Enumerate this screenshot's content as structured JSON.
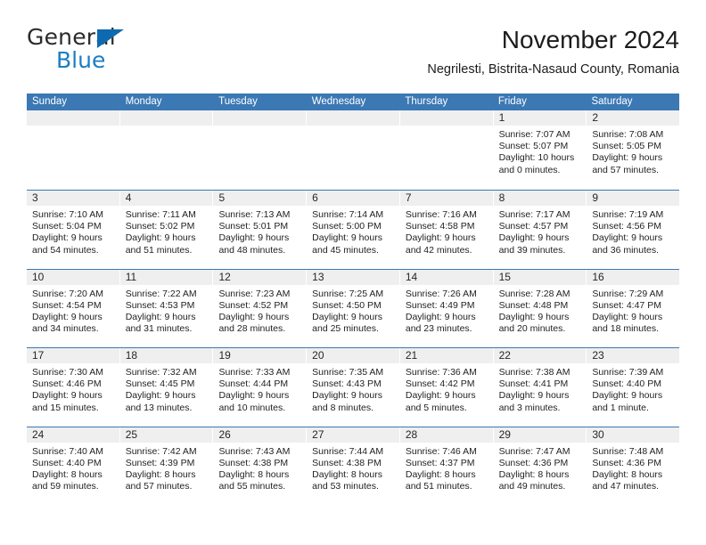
{
  "brand": {
    "name_top": "General",
    "name_bottom": "Blue",
    "triangle_color": "#0e6ab0",
    "blue_text_color": "#1b7ec4"
  },
  "header": {
    "title": "November 2024",
    "subtitle": "Negrilesti, Bistrita-Nasaud County, Romania"
  },
  "theme": {
    "header_blue": "#3b78b4",
    "daynum_band": "#efefef",
    "row_rule": "#3b78b4"
  },
  "weekdays": [
    "Sunday",
    "Monday",
    "Tuesday",
    "Wednesday",
    "Thursday",
    "Friday",
    "Saturday"
  ],
  "weeks": [
    [
      {
        "day": "",
        "lines": []
      },
      {
        "day": "",
        "lines": []
      },
      {
        "day": "",
        "lines": []
      },
      {
        "day": "",
        "lines": []
      },
      {
        "day": "",
        "lines": []
      },
      {
        "day": "1",
        "lines": [
          "Sunrise: 7:07 AM",
          "Sunset: 5:07 PM",
          "Daylight: 10 hours",
          "and 0 minutes."
        ]
      },
      {
        "day": "2",
        "lines": [
          "Sunrise: 7:08 AM",
          "Sunset: 5:05 PM",
          "Daylight: 9 hours",
          "and 57 minutes."
        ]
      }
    ],
    [
      {
        "day": "3",
        "lines": [
          "Sunrise: 7:10 AM",
          "Sunset: 5:04 PM",
          "Daylight: 9 hours",
          "and 54 minutes."
        ]
      },
      {
        "day": "4",
        "lines": [
          "Sunrise: 7:11 AM",
          "Sunset: 5:02 PM",
          "Daylight: 9 hours",
          "and 51 minutes."
        ]
      },
      {
        "day": "5",
        "lines": [
          "Sunrise: 7:13 AM",
          "Sunset: 5:01 PM",
          "Daylight: 9 hours",
          "and 48 minutes."
        ]
      },
      {
        "day": "6",
        "lines": [
          "Sunrise: 7:14 AM",
          "Sunset: 5:00 PM",
          "Daylight: 9 hours",
          "and 45 minutes."
        ]
      },
      {
        "day": "7",
        "lines": [
          "Sunrise: 7:16 AM",
          "Sunset: 4:58 PM",
          "Daylight: 9 hours",
          "and 42 minutes."
        ]
      },
      {
        "day": "8",
        "lines": [
          "Sunrise: 7:17 AM",
          "Sunset: 4:57 PM",
          "Daylight: 9 hours",
          "and 39 minutes."
        ]
      },
      {
        "day": "9",
        "lines": [
          "Sunrise: 7:19 AM",
          "Sunset: 4:56 PM",
          "Daylight: 9 hours",
          "and 36 minutes."
        ]
      }
    ],
    [
      {
        "day": "10",
        "lines": [
          "Sunrise: 7:20 AM",
          "Sunset: 4:54 PM",
          "Daylight: 9 hours",
          "and 34 minutes."
        ]
      },
      {
        "day": "11",
        "lines": [
          "Sunrise: 7:22 AM",
          "Sunset: 4:53 PM",
          "Daylight: 9 hours",
          "and 31 minutes."
        ]
      },
      {
        "day": "12",
        "lines": [
          "Sunrise: 7:23 AM",
          "Sunset: 4:52 PM",
          "Daylight: 9 hours",
          "and 28 minutes."
        ]
      },
      {
        "day": "13",
        "lines": [
          "Sunrise: 7:25 AM",
          "Sunset: 4:50 PM",
          "Daylight: 9 hours",
          "and 25 minutes."
        ]
      },
      {
        "day": "14",
        "lines": [
          "Sunrise: 7:26 AM",
          "Sunset: 4:49 PM",
          "Daylight: 9 hours",
          "and 23 minutes."
        ]
      },
      {
        "day": "15",
        "lines": [
          "Sunrise: 7:28 AM",
          "Sunset: 4:48 PM",
          "Daylight: 9 hours",
          "and 20 minutes."
        ]
      },
      {
        "day": "16",
        "lines": [
          "Sunrise: 7:29 AM",
          "Sunset: 4:47 PM",
          "Daylight: 9 hours",
          "and 18 minutes."
        ]
      }
    ],
    [
      {
        "day": "17",
        "lines": [
          "Sunrise: 7:30 AM",
          "Sunset: 4:46 PM",
          "Daylight: 9 hours",
          "and 15 minutes."
        ]
      },
      {
        "day": "18",
        "lines": [
          "Sunrise: 7:32 AM",
          "Sunset: 4:45 PM",
          "Daylight: 9 hours",
          "and 13 minutes."
        ]
      },
      {
        "day": "19",
        "lines": [
          "Sunrise: 7:33 AM",
          "Sunset: 4:44 PM",
          "Daylight: 9 hours",
          "and 10 minutes."
        ]
      },
      {
        "day": "20",
        "lines": [
          "Sunrise: 7:35 AM",
          "Sunset: 4:43 PM",
          "Daylight: 9 hours",
          "and 8 minutes."
        ]
      },
      {
        "day": "21",
        "lines": [
          "Sunrise: 7:36 AM",
          "Sunset: 4:42 PM",
          "Daylight: 9 hours",
          "and 5 minutes."
        ]
      },
      {
        "day": "22",
        "lines": [
          "Sunrise: 7:38 AM",
          "Sunset: 4:41 PM",
          "Daylight: 9 hours",
          "and 3 minutes."
        ]
      },
      {
        "day": "23",
        "lines": [
          "Sunrise: 7:39 AM",
          "Sunset: 4:40 PM",
          "Daylight: 9 hours",
          "and 1 minute."
        ]
      }
    ],
    [
      {
        "day": "24",
        "lines": [
          "Sunrise: 7:40 AM",
          "Sunset: 4:40 PM",
          "Daylight: 8 hours",
          "and 59 minutes."
        ]
      },
      {
        "day": "25",
        "lines": [
          "Sunrise: 7:42 AM",
          "Sunset: 4:39 PM",
          "Daylight: 8 hours",
          "and 57 minutes."
        ]
      },
      {
        "day": "26",
        "lines": [
          "Sunrise: 7:43 AM",
          "Sunset: 4:38 PM",
          "Daylight: 8 hours",
          "and 55 minutes."
        ]
      },
      {
        "day": "27",
        "lines": [
          "Sunrise: 7:44 AM",
          "Sunset: 4:38 PM",
          "Daylight: 8 hours",
          "and 53 minutes."
        ]
      },
      {
        "day": "28",
        "lines": [
          "Sunrise: 7:46 AM",
          "Sunset: 4:37 PM",
          "Daylight: 8 hours",
          "and 51 minutes."
        ]
      },
      {
        "day": "29",
        "lines": [
          "Sunrise: 7:47 AM",
          "Sunset: 4:36 PM",
          "Daylight: 8 hours",
          "and 49 minutes."
        ]
      },
      {
        "day": "30",
        "lines": [
          "Sunrise: 7:48 AM",
          "Sunset: 4:36 PM",
          "Daylight: 8 hours",
          "and 47 minutes."
        ]
      }
    ]
  ]
}
